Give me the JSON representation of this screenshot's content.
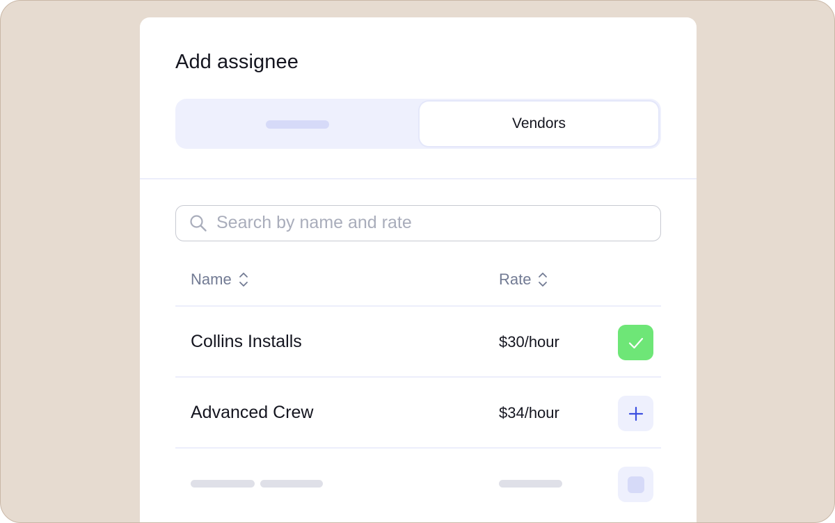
{
  "dialog": {
    "title": "Add assignee",
    "tabs": [
      {
        "label": "",
        "active": false
      },
      {
        "label": "Vendors",
        "active": true
      }
    ]
  },
  "search": {
    "placeholder": "Search by name and rate",
    "value": ""
  },
  "table": {
    "columns": [
      {
        "label": "Name",
        "sortable": true,
        "icon": "sort-icon"
      },
      {
        "label": "Rate",
        "sortable": true,
        "icon": "sort-icon"
      }
    ],
    "rows": [
      {
        "name": "Collins Installs",
        "rate": "$30/hour",
        "action": "check-icon",
        "selected": true
      },
      {
        "name": "Advanced Crew",
        "rate": "$34/hour",
        "action": "plus-icon",
        "selected": false
      }
    ]
  },
  "colors": {
    "accent": "#3c4fe0",
    "selected_green": "#6ee677",
    "surface_tint": "#eef0fd",
    "backdrop": "#e6dbd0"
  }
}
